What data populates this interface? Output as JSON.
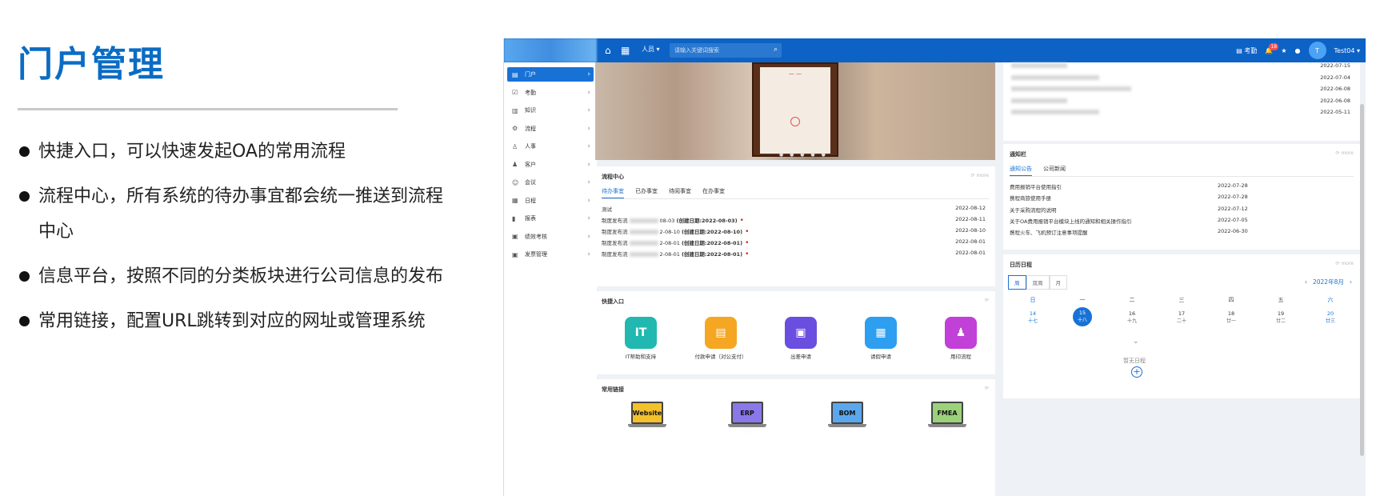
{
  "slide": {
    "title": "门户管理",
    "bullets": [
      "快捷入口，可以快速发起OA的常用流程",
      "流程中心，所有系统的待办事宜都会统一推送到流程中心",
      "信息平台，按照不同的分类板块进行公司信息的发布",
      "常用链接，配置URL跳转到对应的网址或管理系统"
    ]
  },
  "topbar": {
    "people": "人员",
    "search_placeholder": "请输入关键词搜索",
    "attendance": "考勤",
    "notify_count": "18",
    "user": "Test04",
    "avatar_letter": "T"
  },
  "sidebar": {
    "items": [
      {
        "label": "门户",
        "icon": "▤"
      },
      {
        "label": "考勤",
        "icon": "☑"
      },
      {
        "label": "知识",
        "icon": "▥"
      },
      {
        "label": "流程",
        "icon": "⚙"
      },
      {
        "label": "人事",
        "icon": "♙"
      },
      {
        "label": "客户",
        "icon": "♟"
      },
      {
        "label": "会议",
        "icon": "☺"
      },
      {
        "label": "日程",
        "icon": "▦"
      },
      {
        "label": "报表",
        "icon": "▮"
      },
      {
        "label": "绩效考核",
        "icon": "▣"
      },
      {
        "label": "发票管理",
        "icon": "▣"
      }
    ]
  },
  "top_right_list": {
    "dates": [
      "2022-07-15",
      "2022-07-04",
      "2022-06-08",
      "2022-06-08",
      "2022-05-11"
    ]
  },
  "workflow": {
    "title": "流程中心",
    "tabs": [
      "待办事宜",
      "已办事宜",
      "待阅事宜",
      "在办事宜"
    ],
    "rows": [
      {
        "prefix": "测试",
        "mid": "",
        "created": "",
        "date": "2022-08-12",
        "flag": false
      },
      {
        "prefix": "制度发布流",
        "mid": "08-03",
        "created": "(创建日期:2022-08-03)",
        "date": "2022-08-11",
        "flag": true
      },
      {
        "prefix": "制度发布流",
        "mid": "2-08-10",
        "created": "(创建日期:2022-08-10)",
        "date": "2022-08-10",
        "flag": true
      },
      {
        "prefix": "制度发布流",
        "mid": "2-08-01",
        "created": "(创建日期:2022-08-01)",
        "date": "2022-08-01",
        "flag": true
      },
      {
        "prefix": "制度发布流",
        "mid": "2-08-01",
        "created": "(创建日期:2022-08-01)",
        "date": "2022-08-01",
        "flag": true
      }
    ]
  },
  "notice": {
    "title": "通知栏",
    "tabs": [
      "通知公告",
      "公司新闻"
    ],
    "rows": [
      {
        "text": "费用报销平台使用指引",
        "date": "2022-07-28"
      },
      {
        "text": "携程商旅使用手册",
        "date": "2022-07-28"
      },
      {
        "text": "关于采购流程的说明",
        "date": "2022-07-12"
      },
      {
        "text": "关于OA费用报销平台模块上线的通知和相关操作指引",
        "date": "2022-07-05"
      },
      {
        "text": "携程火车、飞机预订注意事项提醒",
        "date": "2022-06-30"
      }
    ]
  },
  "quick_access": {
    "title": "快捷入口",
    "items": [
      {
        "label": "IT帮助和支持",
        "glyph": "IT",
        "color": "#20b8b0"
      },
      {
        "label": "付款申请（对公支付）",
        "glyph": "▤",
        "color": "#f5a623"
      },
      {
        "label": "出差申请",
        "glyph": "▣",
        "color": "#6a4ee0"
      },
      {
        "label": "请假申请",
        "glyph": "▦",
        "color": "#2d9ef0"
      },
      {
        "label": "用印流程",
        "glyph": "♟",
        "color": "#c040d8"
      }
    ]
  },
  "links": {
    "title": "常用链接",
    "items": [
      {
        "label": "Website",
        "color": "#f3c12c"
      },
      {
        "label": "ERP",
        "color": "#8a78e8"
      },
      {
        "label": "BOM",
        "color": "#5aa7ee"
      },
      {
        "label": "FMEA",
        "color": "#9bd17a"
      }
    ]
  },
  "calendar": {
    "title": "日历日程",
    "tabs": [
      "周",
      "双周",
      "月"
    ],
    "month": "2022年8月",
    "weekdays": [
      "日",
      "一",
      "二",
      "三",
      "四",
      "五",
      "六"
    ],
    "days": [
      {
        "d": "14",
        "lunar": "十七"
      },
      {
        "d": "15",
        "lunar": "十八"
      },
      {
        "d": "16",
        "lunar": "十九"
      },
      {
        "d": "17",
        "lunar": "二十"
      },
      {
        "d": "18",
        "lunar": "廿一"
      },
      {
        "d": "19",
        "lunar": "廿二"
      },
      {
        "d": "20",
        "lunar": "廿三"
      }
    ],
    "today_index": 1,
    "empty": "暂无日程"
  }
}
